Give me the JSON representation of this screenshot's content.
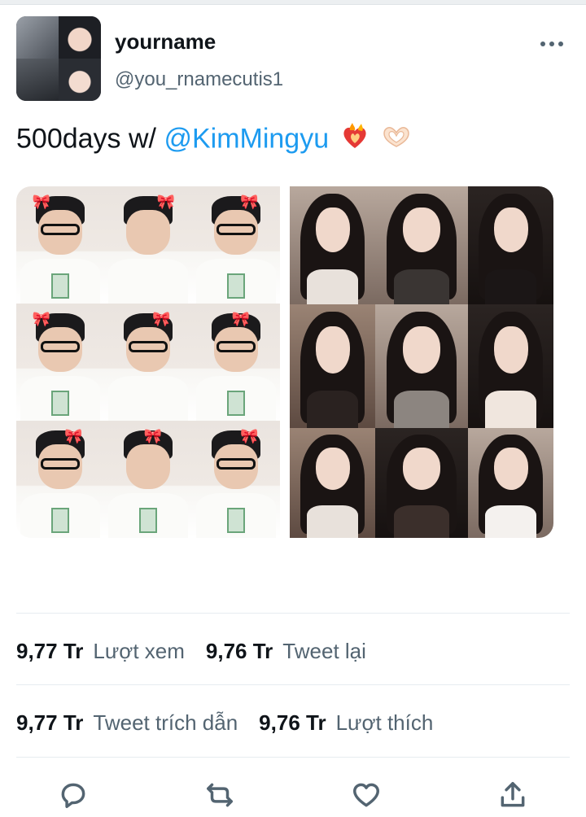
{
  "tweet": {
    "display_name": "yourname",
    "handle": "@you_rnamecutis1",
    "text": "500days w/ ",
    "mention": "@KimMingyu",
    "emojis": [
      "heart-on-fire",
      "heart-hands"
    ]
  },
  "stats": {
    "row1": [
      {
        "value": "9,77 Tr",
        "label": "Lượt xem"
      },
      {
        "value": "9,76 Tr",
        "label": "Tweet lại"
      }
    ],
    "row2": [
      {
        "value": "9,77 Tr",
        "label": "Tweet trích dẫn"
      },
      {
        "value": "9,76 Tr",
        "label": "Lượt thích"
      }
    ]
  },
  "actions": [
    "reply-icon",
    "retweet-icon",
    "like-icon",
    "share-icon"
  ],
  "colors": {
    "mention": "#1d9bf0",
    "secondary_text": "#536471",
    "primary_text": "#0f1419",
    "divider": "#e6ecf0"
  }
}
